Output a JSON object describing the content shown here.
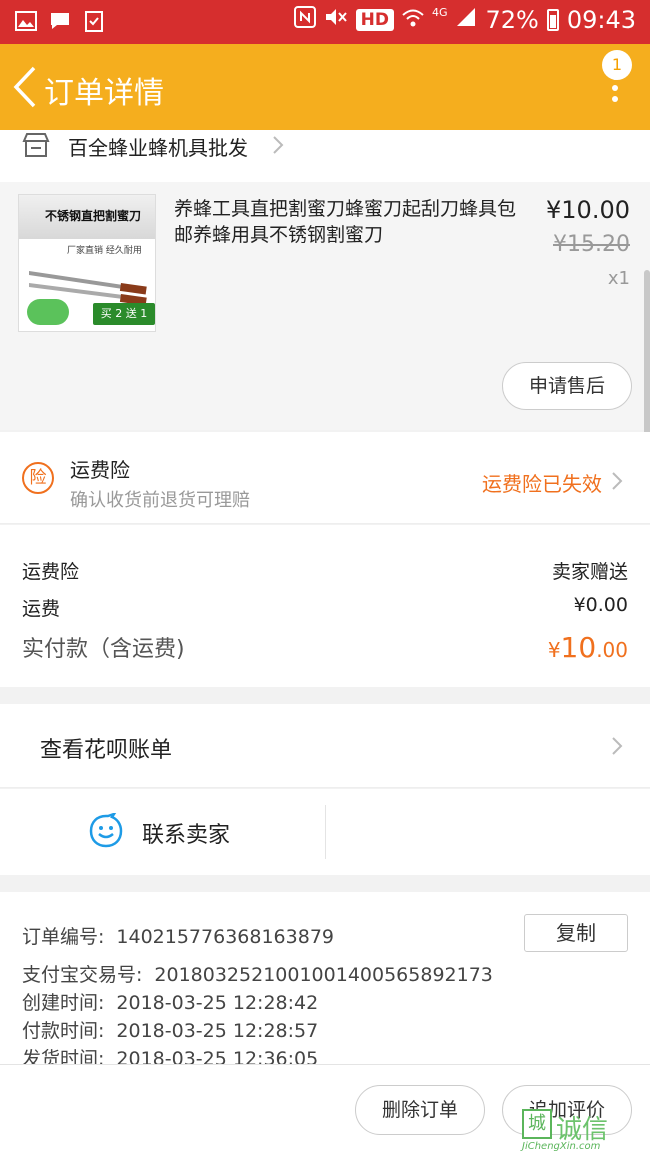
{
  "status_bar": {
    "hd": "HD",
    "network": "4G",
    "battery": "72%",
    "time": "09:43"
  },
  "header": {
    "title": "订单详情",
    "badge_count": "1"
  },
  "shop": {
    "name": "百全蜂业蜂机具批发"
  },
  "product": {
    "thumb_title": "不锈钢直把割蜜刀",
    "thumb_sub": "厂家直销 经久耐用",
    "thumb_promo": "买 2 送 1",
    "title": "养蜂工具直把割蜜刀蜂蜜刀起刮刀蜂具包邮养蜂用具不锈钢割蜜刀",
    "price": "¥10.00",
    "original_price": "¥15.20",
    "quantity": "x1",
    "after_sale_label": "申请售后"
  },
  "insurance": {
    "icon_char": "险",
    "title": "运费险",
    "description": "确认收货前退货可理赔",
    "status": "运费险已失效"
  },
  "fees": {
    "insurance_label": "运费险",
    "insurance_value": "卖家赠送",
    "shipping_label": "运费",
    "shipping_value": "¥0.00",
    "total_label": "实付款（含运费)",
    "total_currency": "¥",
    "total_integer": "10",
    "total_decimal": ".00"
  },
  "huabei": {
    "label": "查看花呗账单"
  },
  "contact": {
    "label": "联系卖家"
  },
  "order_info": {
    "order_no_label": "订单编号:",
    "order_no": "140215776368163879",
    "copy_label": "复制",
    "alipay_label": "支付宝交易号:",
    "alipay_no": "2018032521001001400565892173",
    "created_label": "创建时间:",
    "created": "2018-03-25 12:28:42",
    "paid_label": "付款时间:",
    "paid": "2018-03-25 12:28:57",
    "shipped_label": "发货时间:",
    "shipped": "2018-03-25 12:36:05"
  },
  "actions": {
    "delete_label": "删除订单",
    "review_label": "追加评价"
  },
  "watermark": {
    "box_char": "城",
    "text": "诚信",
    "url": "JiChengXin.com"
  },
  "colors": {
    "status_bar": "#d62e2e",
    "title_bar": "#f5ae1e",
    "accent": "#f0701e",
    "link_blue": "#1e9be6"
  }
}
